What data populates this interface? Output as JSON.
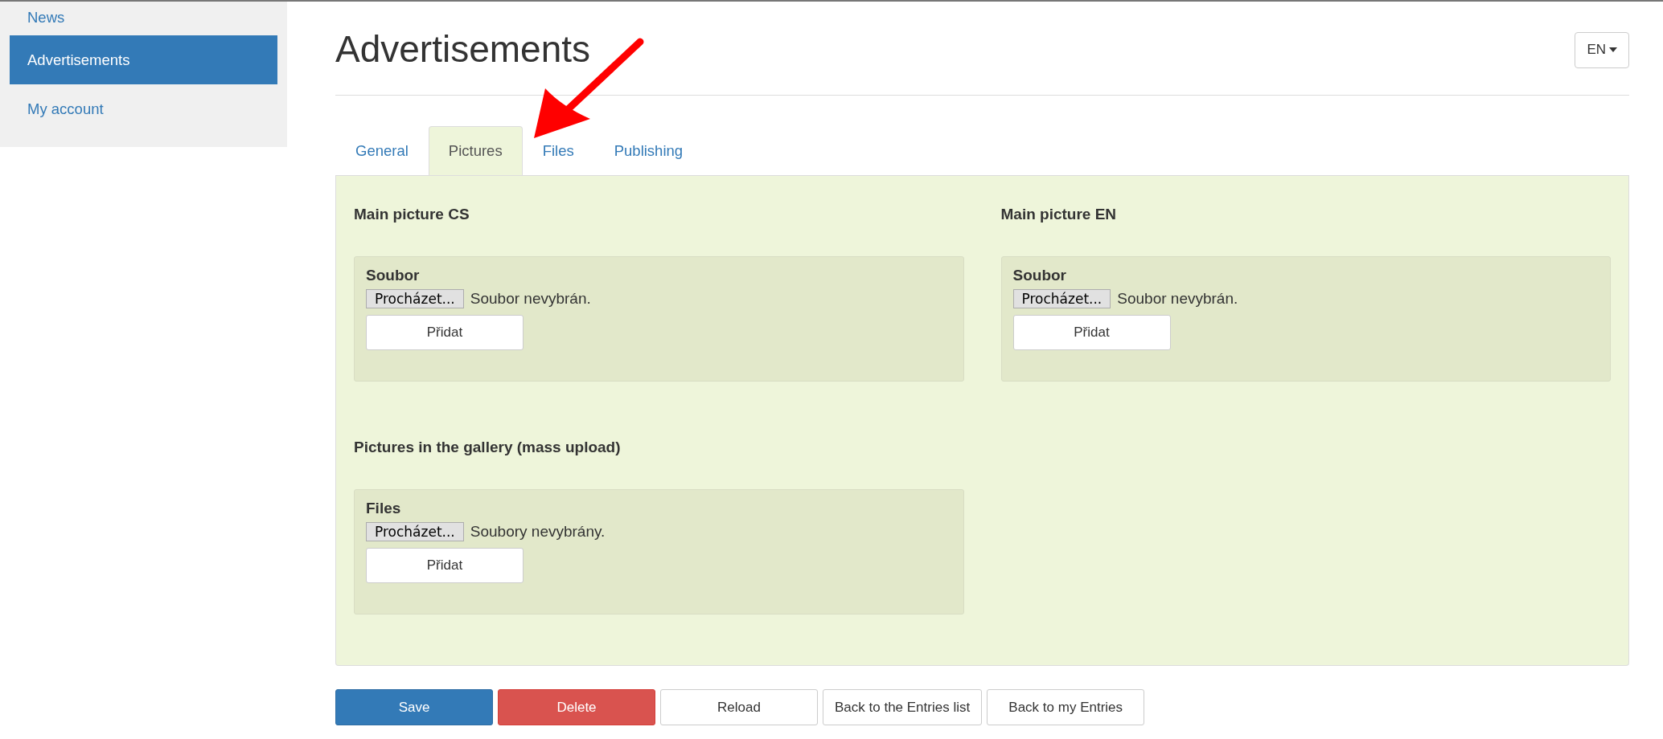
{
  "sidebar": {
    "items": [
      {
        "label": "News",
        "selected": false
      },
      {
        "label": "Advertisements",
        "selected": true
      },
      {
        "label": "My account",
        "selected": false
      }
    ]
  },
  "page": {
    "title": "Advertisements",
    "language": "EN"
  },
  "tabs": [
    {
      "label": "General",
      "selected": false
    },
    {
      "label": "Pictures",
      "selected": true
    },
    {
      "label": "Files",
      "selected": false
    },
    {
      "label": "Publishing",
      "selected": false
    }
  ],
  "sections": [
    {
      "heading": "Main picture CS",
      "field_label": "Soubor",
      "browse": "Procházet...",
      "status": "Soubor nevybrán.",
      "add": "Přidat"
    },
    {
      "heading": "Main picture EN",
      "field_label": "Soubor",
      "browse": "Procházet...",
      "status": "Soubor nevybrán.",
      "add": "Přidat"
    },
    {
      "heading": "Pictures in the gallery (mass upload)",
      "field_label": "Files",
      "browse": "Procházet...",
      "status": "Soubory nevybrány.",
      "add": "Přidat"
    }
  ],
  "buttons": [
    {
      "label": "Save",
      "kind": "primary"
    },
    {
      "label": "Delete",
      "kind": "danger"
    },
    {
      "label": "Reload",
      "kind": "default"
    },
    {
      "label": "Back to the Entries list",
      "kind": "default"
    },
    {
      "label": "Back to my Entries",
      "kind": "default"
    }
  ]
}
